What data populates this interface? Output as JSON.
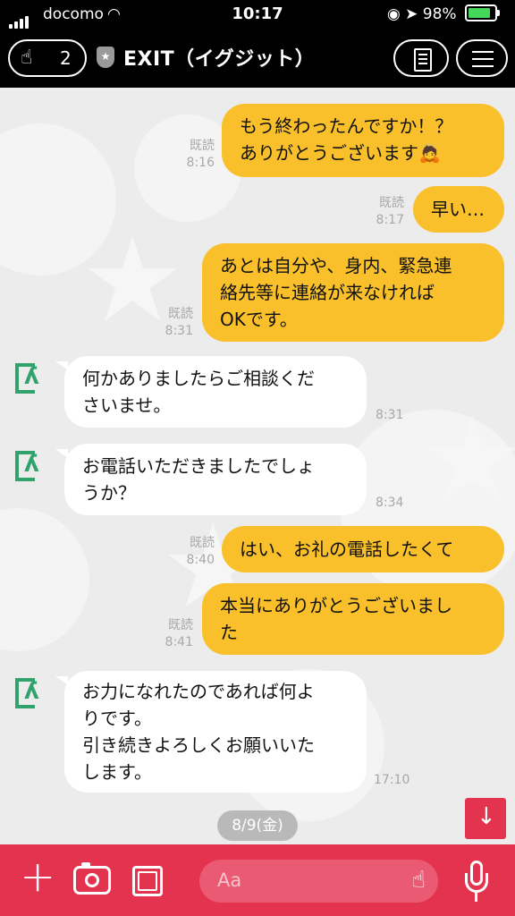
{
  "status": {
    "carrier": "docomo",
    "time": "10:17",
    "battery_text": "98%",
    "battery_level": 0.98
  },
  "header": {
    "follow_count": "2",
    "title": "EXIT（イグジット）",
    "icons": [
      "hand-icon",
      "shield-star-icon",
      "note-icon",
      "menu-icon"
    ]
  },
  "messages": {
    "m0": {
      "lines": [
        "もう終わったんですか！？",
        "ありがとうございます🙇"
      ],
      "read": "既読",
      "time": "8:16"
    },
    "m1": {
      "lines": [
        "早い…"
      ],
      "read": "既読",
      "time": "8:17"
    },
    "m2": {
      "lines": [
        "あとは自分や、身内、緊急連",
        "絡先等に連絡が来なければ",
        "OKです。"
      ],
      "read": "既読",
      "time": "8:31"
    },
    "m3": {
      "lines": [
        "何かありましたらご相談くだ",
        "さいませ。"
      ],
      "time": "8:31"
    },
    "m4": {
      "lines": [
        "お電話いただきましたでしょ",
        "うか？"
      ],
      "time": "8:34"
    },
    "m5": {
      "lines": [
        "はい、お礼の電話したくて"
      ],
      "read": "既読",
      "time": "8:40"
    },
    "m6": {
      "lines": [
        "本当にありがとうございまし",
        "た"
      ],
      "read": "既読",
      "time": "8:41"
    },
    "m7": {
      "lines": [
        "お力になれたのであれば何よ",
        "りです。",
        "引き続きよろしくお願いいた",
        "します。"
      ],
      "time": "17:10"
    }
  },
  "date_separator": "8/9(金)",
  "input": {
    "placeholder": "Aa"
  },
  "colors": {
    "outgoing_bubble": "#f9c02c",
    "incoming_bubble": "#ffffff",
    "input_bar": "#e3334f",
    "header": "#000000",
    "brand_green": "#2fa36b"
  }
}
